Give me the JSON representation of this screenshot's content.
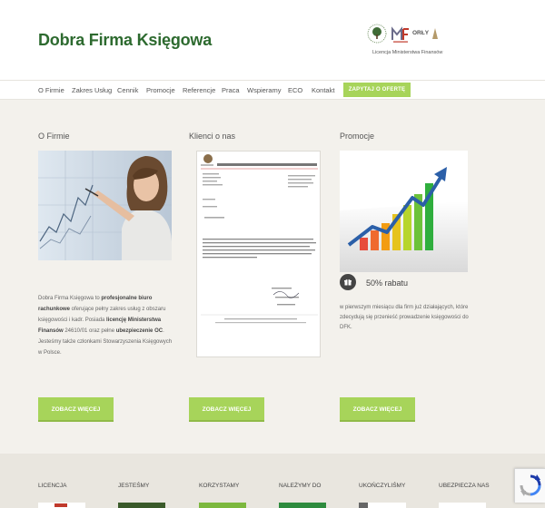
{
  "header": {
    "logo": "Dobra Firma Księgowa",
    "badges": {
      "orly": "ORŁY"
    },
    "license_text": "Licencja Ministerstwa Finansów"
  },
  "nav": {
    "items": [
      {
        "label": "O Firmie"
      },
      {
        "label": "Zakres Usług"
      },
      {
        "label": "Cennik"
      },
      {
        "label": "Promocje"
      },
      {
        "label": "Referencje"
      },
      {
        "label": "Praca"
      },
      {
        "label": "Wspieramy"
      },
      {
        "label": "ECO"
      },
      {
        "label": "Kontakt"
      }
    ],
    "cta": "ZAPYTAJ O OFERTĘ"
  },
  "columns": {
    "about": {
      "title": "O Firmie",
      "text_parts": [
        "Dobra Firma Księgowa to ",
        "profesjonalne biuro rachunkowe",
        " oferujące pełny zakres usług z obszaru księgowości i kadr. Posiada ",
        "licencję Ministerstwa Finansów",
        " 24610/01 oraz pełne ",
        "ubezpieczenie OC",
        ". Jesteśmy także członkami Stowarzyszenia Księgowych w Polsce."
      ],
      "button": "ZOBACZ WIĘCEJ"
    },
    "clients": {
      "title": "Klienci o nas",
      "button": "ZOBACZ WIĘCEJ"
    },
    "promo": {
      "title": "Promocje",
      "headline": "50% rabatu",
      "text": "w pierwszym miesiącu dla firm już działających, które zdecydują się przenieść prowadzenie księgowości do DFK.",
      "button": "ZOBACZ WIĘCEJ"
    }
  },
  "footer": {
    "titles": [
      "LICENCJA",
      "JESTEŚMY",
      "KORZYSTAMY",
      "NALEŻYMY DO",
      "UKOŃCZYLIŚMY",
      "UBEZPIECZA NAS"
    ]
  },
  "colors": {
    "brand_green": "#2d6a2f",
    "button_green": "#a7d45a",
    "background": "#f3f1ec"
  },
  "icons": {
    "promo_badge": "gift-icon",
    "recaptcha": "recaptcha-icon"
  }
}
